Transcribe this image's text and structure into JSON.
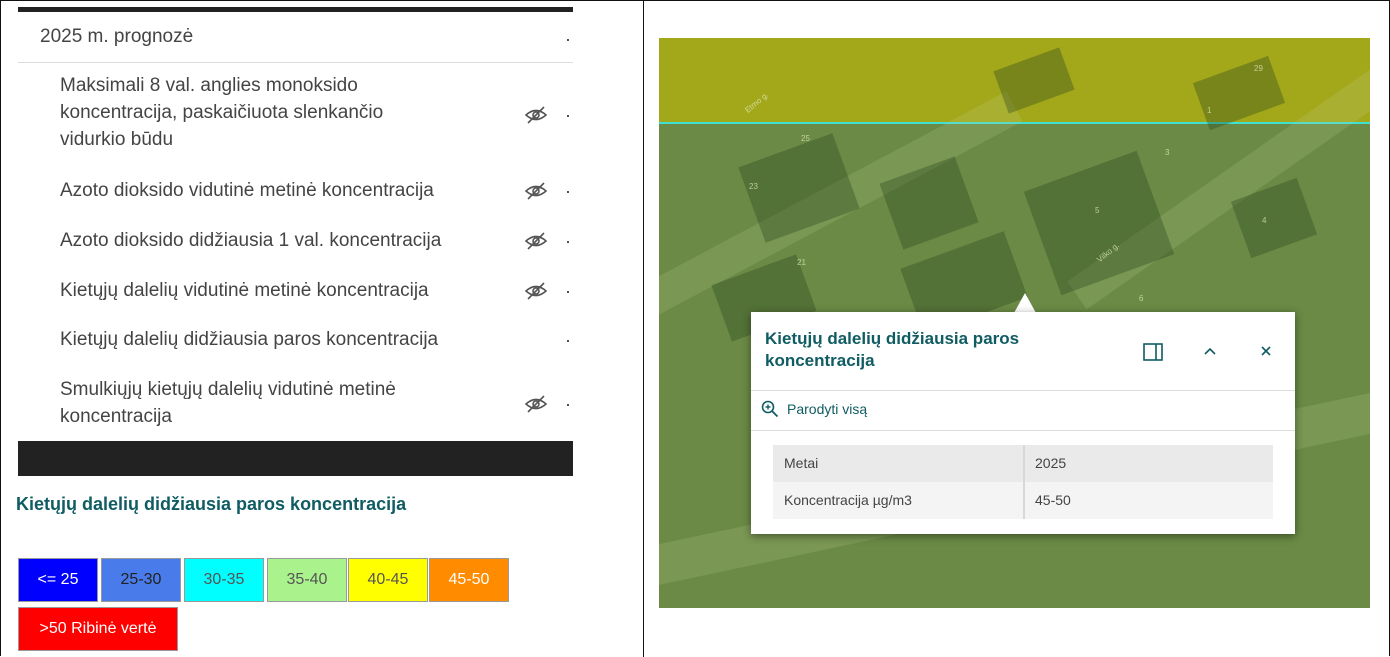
{
  "layer_list": {
    "group_title": "2025 m. prognozė",
    "layers": [
      {
        "label": "Maksimali 8 val. anglies monoksido koncentracija, paskaičiuota slenkančio vidurkio būdu",
        "hidden_icon": "eye-slash-icon"
      },
      {
        "label": "Azoto dioksido vidutinė metinė koncentracija",
        "hidden_icon": "eye-slash-icon"
      },
      {
        "label": "Azoto dioksido didžiausia 1 val. koncentracija",
        "hidden_icon": "eye-slash-icon"
      },
      {
        "label": "Kietųjų dalelių vidutinė metinė koncentracija",
        "hidden_icon": "eye-slash-icon"
      },
      {
        "label": "Kietųjų dalelių didžiausia paros koncentracija",
        "hidden_icon": ""
      },
      {
        "label": "Smulkiųjų kietųjų dalelių vidutinė metinė koncentracija",
        "hidden_icon": "eye-slash-icon"
      }
    ]
  },
  "legend": {
    "title": "Kietųjų dalelių didžiausia paros koncentracija",
    "items": [
      {
        "label": "<= 25",
        "color": "#0000ff",
        "text_color": "#ffffff"
      },
      {
        "label": "25-30",
        "color": "#4a7bea",
        "text_color": "#222222"
      },
      {
        "label": "30-35",
        "color": "#00ffff",
        "text_color": "#555555"
      },
      {
        "label": "35-40",
        "color": "#aaf38c",
        "text_color": "#555555"
      },
      {
        "label": "40-45",
        "color": "#ffff00",
        "text_color": "#555555"
      },
      {
        "label": "45-50",
        "color": "#ff8c00",
        "text_color": "#ffffff"
      },
      {
        "label": ">50 Ribinė vertė",
        "color": "#ff0000",
        "text_color": "#ffffff"
      }
    ]
  },
  "map": {
    "street_labels": [
      "Etmo g.",
      "Vilko g."
    ],
    "house_numbers": [
      "29",
      "1",
      "25",
      "23",
      "3",
      "5",
      "4",
      "21",
      "6"
    ]
  },
  "popup": {
    "title": "Kietųjų dalelių didžiausia paros koncentracija",
    "dock_icon": "dock-panel-icon",
    "collapse_icon": "chevron-up-icon",
    "close_icon": "close-icon",
    "zoom_label": "Parodyti visą",
    "rows": [
      {
        "field": "Metai",
        "value": "2025"
      },
      {
        "field": "Koncentracija µg/m3",
        "value": "45-50"
      }
    ]
  },
  "colors": {
    "accent": "#0f5c63",
    "map_highlight": "#a3a81b",
    "map_base": "#6a8a45"
  }
}
